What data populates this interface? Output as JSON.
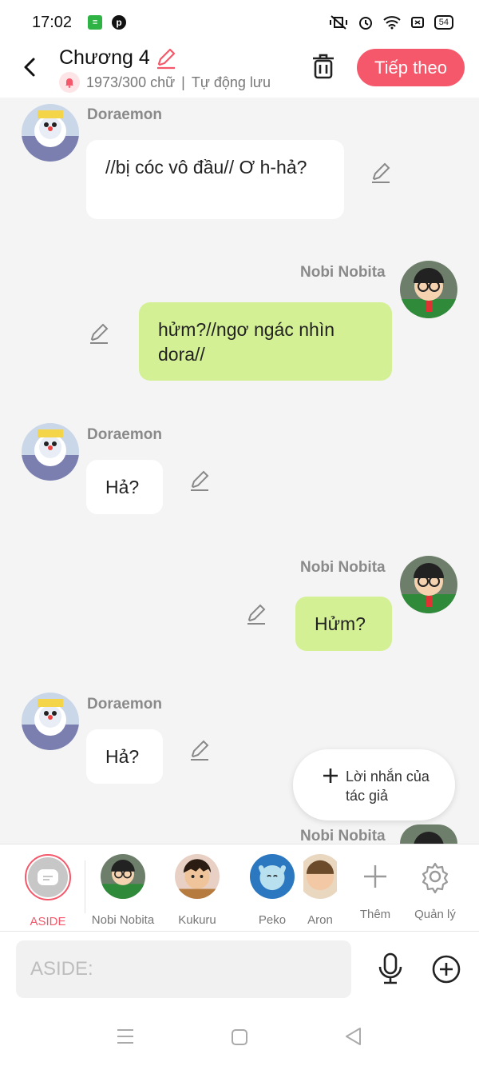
{
  "status": {
    "time": "17:02",
    "battery": "54"
  },
  "header": {
    "title": "Chương 4",
    "word_count": "1973/300 chữ",
    "separator": "|",
    "autosave": "Tự động lưu",
    "next_label": "Tiếp theo"
  },
  "messages": [
    {
      "sender": "Doraemon",
      "text": "//bị cóc vô đầu// Ơ h-hả?",
      "side": "left"
    },
    {
      "sender": "Nobi Nobita",
      "text": "hửm?//ngơ ngác nhìn dora//",
      "side": "right"
    },
    {
      "sender": "Doraemon",
      "text": "Hả?",
      "side": "left"
    },
    {
      "sender": "Nobi Nobita",
      "text": "Hửm?",
      "side": "right"
    },
    {
      "sender": "Doraemon",
      "text": "Hả?",
      "side": "left"
    },
    {
      "sender": "Nobi Nobita",
      "text": "",
      "side": "right"
    }
  ],
  "author_note_label": "Lời nhắn của tác giả",
  "characters": [
    {
      "name": "ASIDE"
    },
    {
      "name": "Nobi Nobita"
    },
    {
      "name": "Kukuru"
    },
    {
      "name": "Peko"
    },
    {
      "name": "Aron"
    }
  ],
  "more_label": "Thêm",
  "manage_label": "Quản lý",
  "input": {
    "placeholder": "ASIDE:"
  },
  "colors": {
    "accent": "#f4586a",
    "green_bubble": "#d3f095",
    "white_bubble": "#ffffff"
  }
}
